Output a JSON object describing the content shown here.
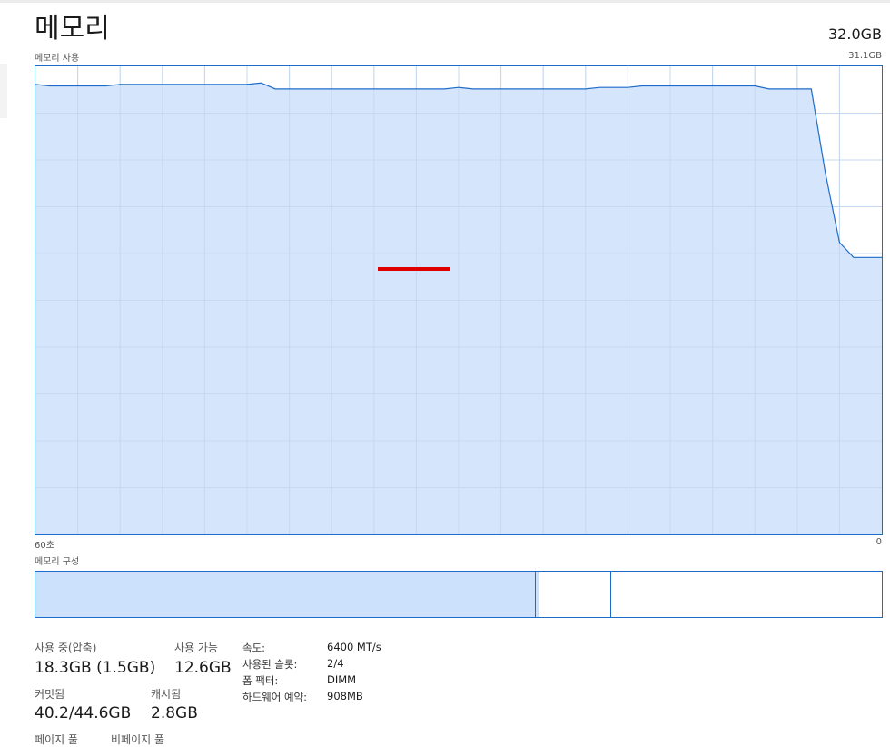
{
  "header": {
    "title": "메모리",
    "total_memory": "32.0GB"
  },
  "usage_graph": {
    "label": "메모리 사용",
    "max_label": "31.1GB",
    "x_left_label": "60초",
    "x_right_label": "0",
    "fill_color": "#cce1fb",
    "line_color": "#1e6cc9",
    "grid_color": "#c5d7ee"
  },
  "chart_data": {
    "type": "area",
    "title": "메모리 사용",
    "xlabel": "",
    "ylabel": "",
    "x": [
      60,
      59,
      58,
      57,
      56,
      55,
      54,
      53,
      52,
      51,
      50,
      49,
      48,
      47,
      46,
      45,
      44,
      43,
      42,
      41,
      40,
      39,
      38,
      37,
      36,
      35,
      34,
      33,
      32,
      31,
      30,
      29,
      28,
      27,
      26,
      25,
      24,
      23,
      22,
      21,
      20,
      19,
      18,
      17,
      16,
      15,
      14,
      13,
      12,
      11,
      10,
      9,
      8,
      7,
      6,
      5,
      4,
      3,
      2,
      1,
      0
    ],
    "values": [
      29.9,
      29.8,
      29.8,
      29.8,
      29.8,
      29.8,
      29.9,
      29.9,
      29.9,
      29.9,
      29.9,
      29.9,
      29.9,
      29.9,
      29.9,
      29.9,
      30.0,
      29.6,
      29.6,
      29.6,
      29.6,
      29.6,
      29.6,
      29.6,
      29.6,
      29.6,
      29.6,
      29.6,
      29.6,
      29.6,
      29.7,
      29.6,
      29.6,
      29.6,
      29.6,
      29.6,
      29.6,
      29.6,
      29.6,
      29.6,
      29.7,
      29.7,
      29.7,
      29.8,
      29.8,
      29.8,
      29.8,
      29.8,
      29.8,
      29.8,
      29.8,
      29.8,
      29.6,
      29.6,
      29.6,
      29.6,
      24.0,
      19.4,
      18.4,
      18.4,
      18.4
    ],
    "ylim": [
      0,
      31.1
    ],
    "xlim": [
      60,
      0
    ],
    "grid": true
  },
  "composition": {
    "label": "메모리 구성",
    "segments": [
      {
        "name": "in-use",
        "fraction": 0.591,
        "color": "#cce1fb"
      },
      {
        "name": "modified",
        "fraction": 0.005,
        "color": "#cce1fb"
      },
      {
        "name": "standby",
        "fraction": 0.084,
        "color": "#ffffff"
      },
      {
        "name": "free",
        "fraction": 0.32,
        "color": "#ffffff"
      }
    ]
  },
  "stats": {
    "in_use_label": "사용 중(압축)",
    "in_use_value": "18.3GB (1.5GB)",
    "available_label": "사용 가능",
    "available_value": "12.6GB",
    "committed_label": "커밋됨",
    "committed_value": "40.2/44.6GB",
    "cached_label": "캐시됨",
    "cached_value": "2.8GB",
    "paged_pool_label": "페이지 풀",
    "nonpaged_pool_label": "비페이지 풀"
  },
  "specs": {
    "speed_label": "속도:",
    "speed_value": "6400 MT/s",
    "slots_label": "사용된 슬롯:",
    "slots_value": "2/4",
    "form_factor_label": "폼 팩터:",
    "form_factor_value": "DIMM",
    "hw_reserved_label": "하드웨어 예약:",
    "hw_reserved_value": "908MB"
  }
}
